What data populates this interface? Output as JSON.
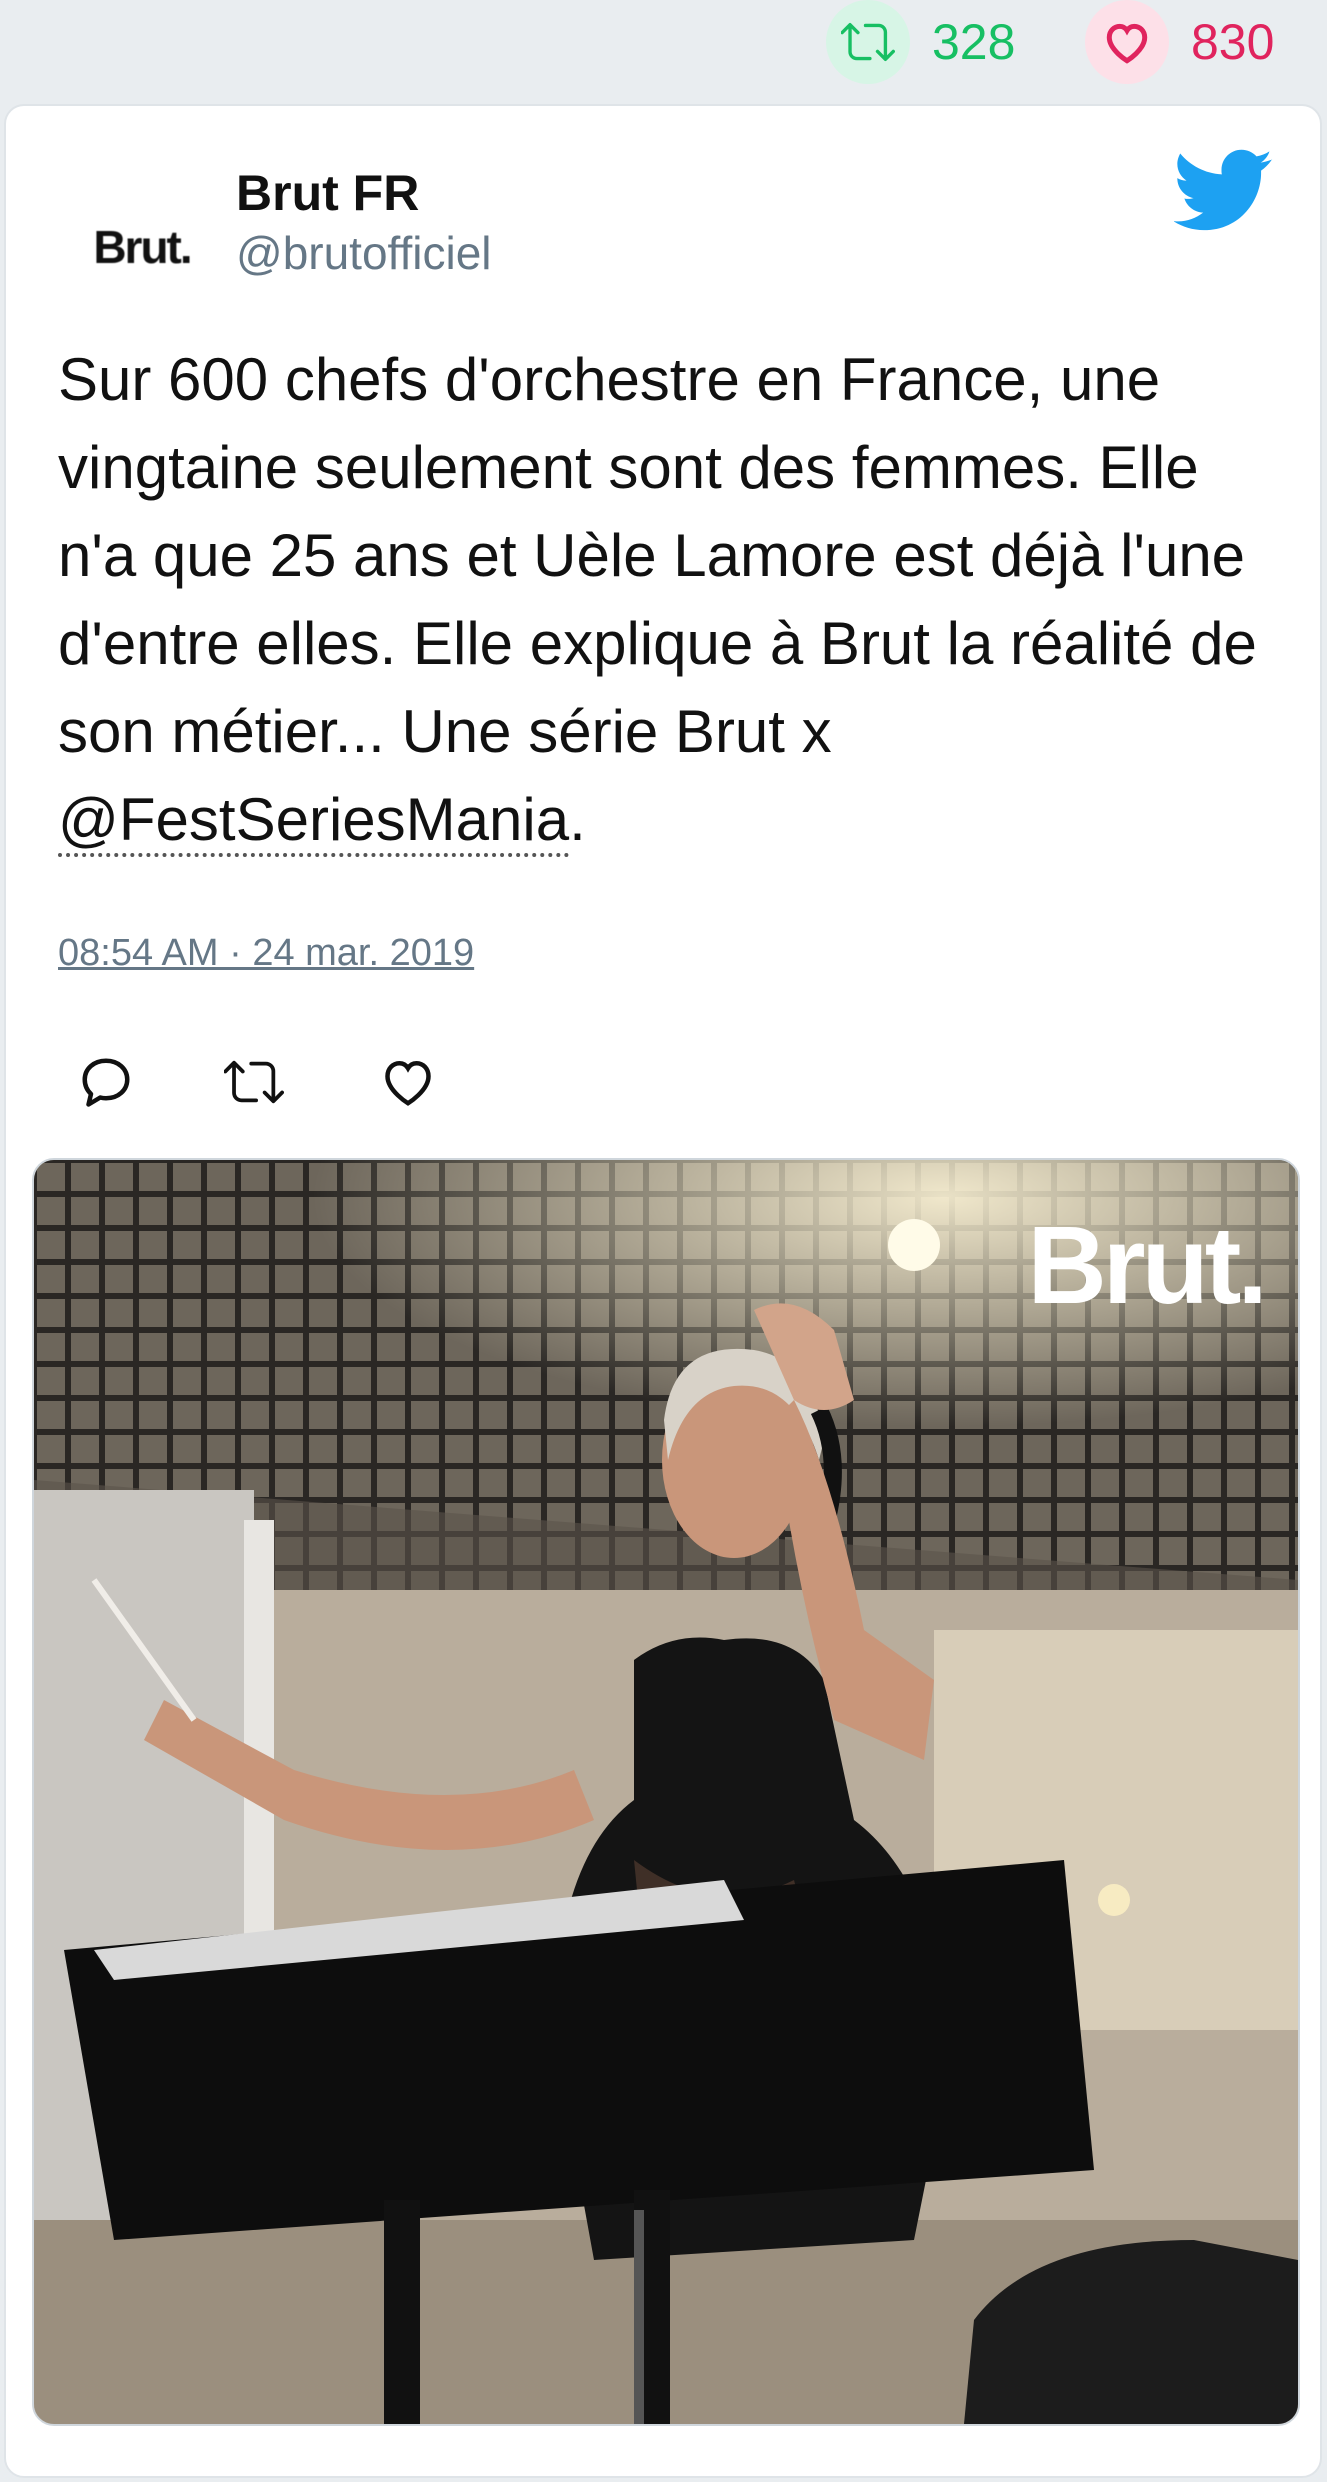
{
  "stats": {
    "retweets": "328",
    "likes": "830",
    "retweet_color": "#17bf63",
    "like_color": "#e0245e"
  },
  "tweet": {
    "author_name": "Brut FR",
    "author_handle": "@brutofficiel",
    "avatar_text": "Brut.",
    "text_before_mention": "Sur 600 chefs d'orchestre en France, une vingtaine seulement sont des femmes. Elle n'a que 25 ans et Uèle Lamore est déjà l'une d'entre elles. Elle explique à Brut la réalité de son métier... Une série Brut x ",
    "mention": "@FestSeriesMania",
    "text_after_mention": ".",
    "timestamp": "08:54 AM · 24 mar. 2019",
    "media_logo": "Brut."
  },
  "icons": {
    "stats_retweet": "retweet-icon",
    "stats_like": "heart-icon",
    "brand": "twitter-bird-icon",
    "actions": [
      "reply-icon",
      "retweet-icon",
      "like-icon"
    ]
  }
}
